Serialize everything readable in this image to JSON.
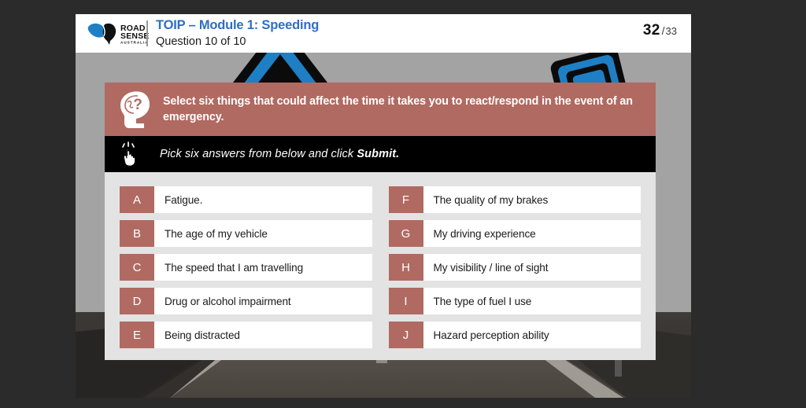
{
  "header": {
    "logo_name": "road-sense-australia-logo",
    "logo_text_line1": "ROAD",
    "logo_text_line2": "SENSE",
    "logo_text_line3": "AUSTRALIA",
    "module_title": "TOIP – Module 1: Speeding",
    "question_counter": "Question 10 of 10",
    "page_current": "32",
    "page_separator": "/",
    "page_total": "33",
    "title_color": "#2e6fc4"
  },
  "question": {
    "icon": "head-question-icon",
    "text": "Select six things that could affect the time it takes you to react/respond  in the event of an emergency.",
    "banner_color": "#b06a62"
  },
  "instruction": {
    "icon": "click-hand-icon",
    "text_before": "Pick six answers from below and click ",
    "text_bold": "Submit.",
    "bar_color": "#000000"
  },
  "answers": {
    "left_column": [
      {
        "letter": "A",
        "label": "Fatigue."
      },
      {
        "letter": "B",
        "label": "The age of my vehicle"
      },
      {
        "letter": "C",
        "label": "The speed that I am travelling"
      },
      {
        "letter": "D",
        "label": "Drug or alcohol impairment"
      },
      {
        "letter": "E",
        "label": "Being distracted"
      }
    ],
    "right_column": [
      {
        "letter": "F",
        "label": "The quality of my brakes"
      },
      {
        "letter": "G",
        "label": "My driving experience"
      },
      {
        "letter": "H",
        "label": "My visibility / line of sight"
      },
      {
        "letter": "I",
        "label": "The type of fuel I use"
      },
      {
        "letter": "J",
        "label": "Hazard perception ability"
      }
    ],
    "letter_box_color": "#b06a62",
    "panel_color": "#e3e3e3",
    "row_color": "#ffffff"
  },
  "background": {
    "sky_color": "#a3a3a3",
    "road_color": "#4a443f",
    "sign_blue": "#1f7fc4",
    "outer_color": "#2b2b2b"
  }
}
